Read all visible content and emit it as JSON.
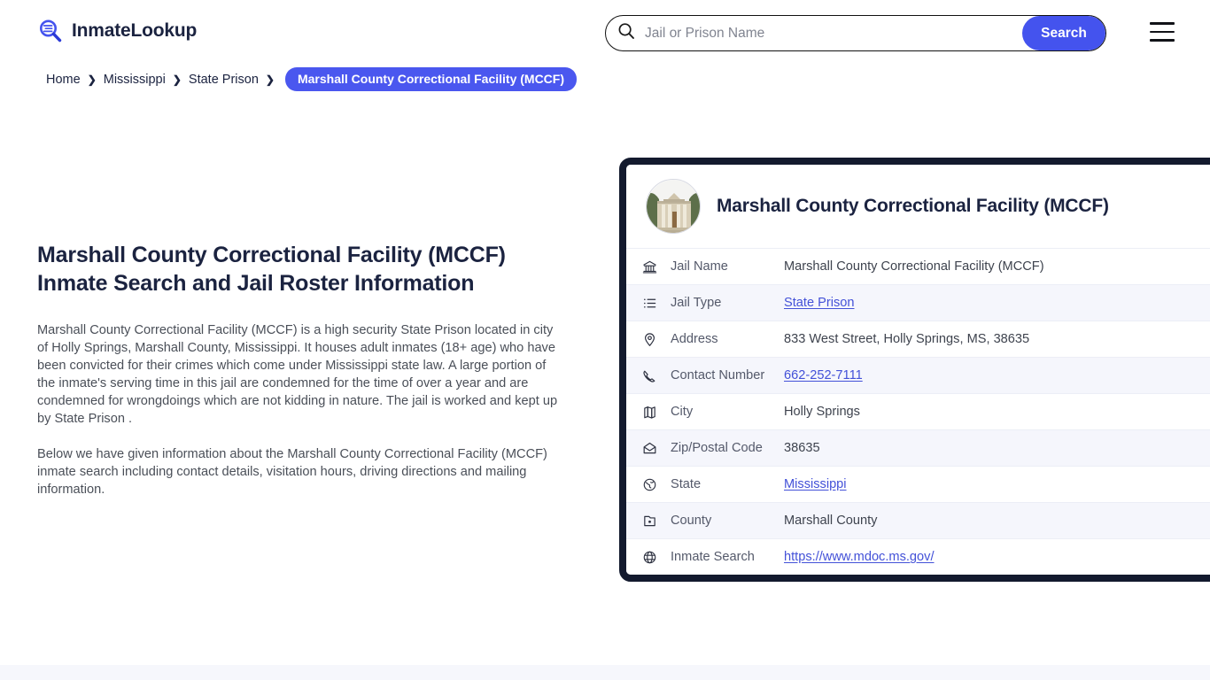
{
  "brand": {
    "name": "InmateLookup",
    "logo_icon": "magnifier-list-icon"
  },
  "search": {
    "placeholder": "Jail or Prison Name",
    "value": "",
    "button_label": "Search",
    "icon": "search-icon",
    "accent_color": "#4453ee"
  },
  "menu": {
    "icon": "hamburger-menu-icon"
  },
  "breadcrumb": {
    "items": [
      {
        "label": "Home",
        "href": "#"
      },
      {
        "label": "Mississippi",
        "href": "#"
      },
      {
        "label": "State Prison",
        "href": "#"
      }
    ],
    "separator": "❯",
    "current": "Marshall County Correctional Facility (MCCF)",
    "current_bg": "#4a57ef"
  },
  "main": {
    "title_line1": "Marshall County Correctional Facility (MCCF)",
    "title_line2": "Inmate Search and Jail Roster Information",
    "paragraph1": "Marshall County Correctional Facility (MCCF) is a high security State Prison located in city of Holly Springs, Marshall County, Mississippi. It houses adult inmates (18+ age) who have been convicted for their crimes which come under Mississippi state law. A large portion of the inmate's serving time in this jail are condemned for the time of over a year and are condemned for wrongdoings which are not kidding in nature. The jail is worked and kept up by State Prison .",
    "paragraph2": "Below we have given information about the Marshall County Correctional Facility (MCCF) inmate search including contact details, visitation hours, driving directions and mailing information."
  },
  "card": {
    "title": "Marshall County Correctional Facility (MCCF)",
    "photo_alt": "facility-building-photo",
    "border_color": "#131a2e",
    "rows": [
      {
        "icon": "bank-icon",
        "label": "Jail Name",
        "value": "Marshall County Correctional Facility (MCCF)",
        "link": false
      },
      {
        "icon": "list-icon",
        "label": "Jail Type",
        "value": "State Prison",
        "link": true
      },
      {
        "icon": "location-pin-icon",
        "label": "Address",
        "value": "833 West Street, Holly Springs, MS, 38635",
        "link": false
      },
      {
        "icon": "phone-icon",
        "label": "Contact Number",
        "value": "662-252-7111",
        "link": true
      },
      {
        "icon": "map-icon",
        "label": "City",
        "value": "Holly Springs",
        "link": false
      },
      {
        "icon": "envelope-icon",
        "label": "Zip/Postal Code",
        "value": "38635",
        "link": false
      },
      {
        "icon": "globe-state-icon",
        "label": "State",
        "value": "Mississippi",
        "link": true
      },
      {
        "icon": "county-icon",
        "label": "County",
        "value": "Marshall County",
        "link": false
      },
      {
        "icon": "web-globe-icon",
        "label": "Inmate Search",
        "value": "https://www.mdoc.ms.gov/",
        "link": true
      }
    ]
  }
}
